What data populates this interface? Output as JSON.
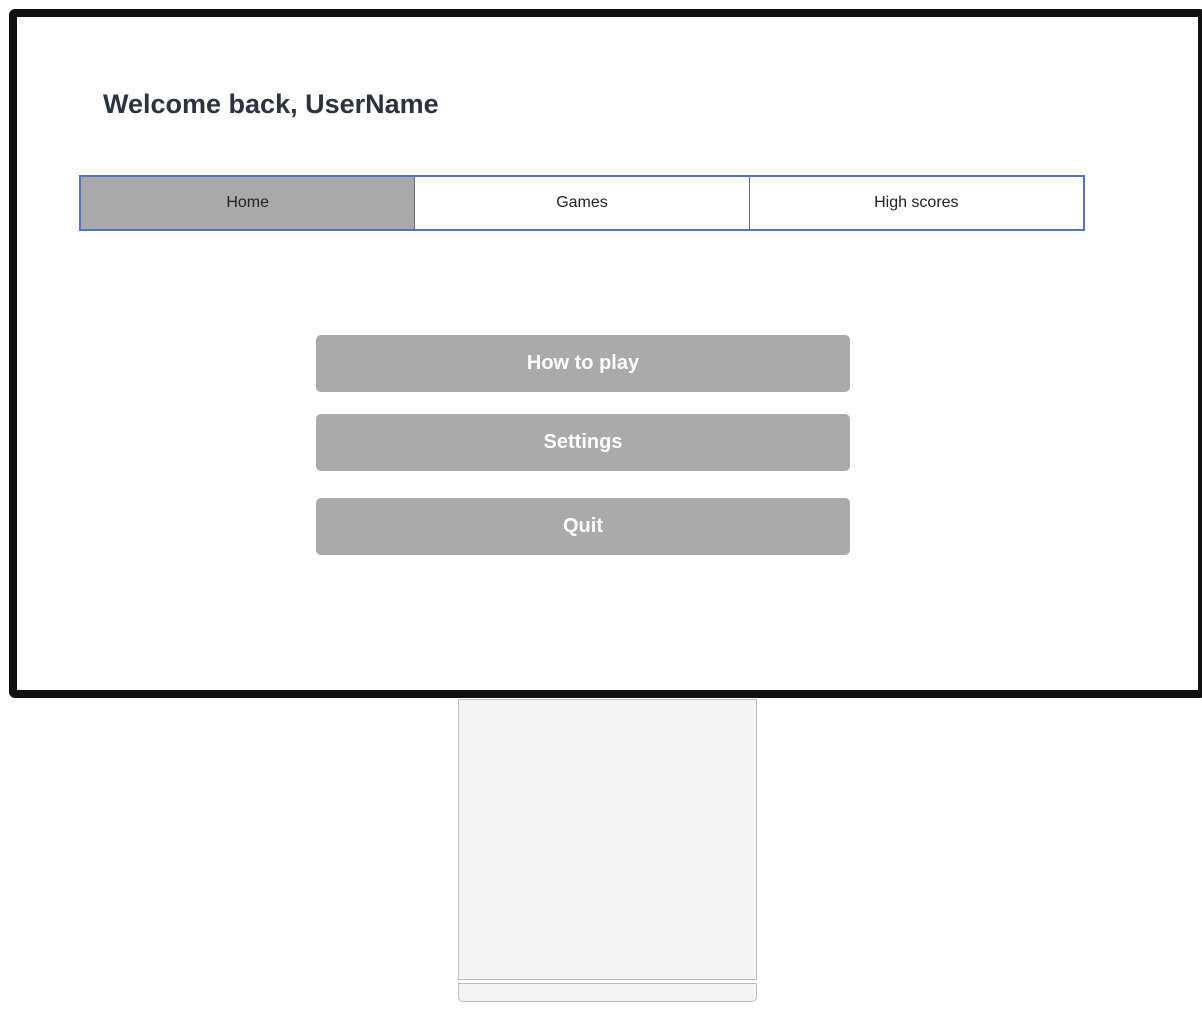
{
  "header": {
    "welcome": "Welcome back, UserName"
  },
  "tabs": [
    {
      "label": "Home",
      "active": true
    },
    {
      "label": "Games",
      "active": false
    },
    {
      "label": "High scores",
      "active": false
    }
  ],
  "menu": {
    "how_to_play": "How to play",
    "settings": "Settings",
    "quit": "Quit"
  },
  "colors": {
    "tab_border": "#5470d6",
    "active_tab": "#a9a9a9",
    "button": "#aaaaaa",
    "title_text": "#2c3340"
  }
}
